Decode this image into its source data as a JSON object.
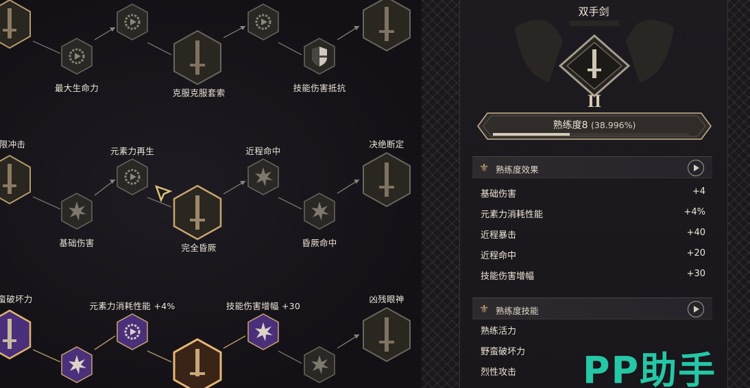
{
  "tree": {
    "row1": {
      "labels": [
        "最大生命力",
        "克服克服套索",
        "技能伤害抵抗"
      ]
    },
    "row2": {
      "labels": [
        "限冲击",
        "元素力再生",
        "近程命中",
        "决绝断定",
        "基础伤害",
        "完全昏厥",
        "昏厥命中"
      ]
    },
    "row3": {
      "labels": [
        "蛮破坏力",
        "元素力消耗性能 +4%",
        "技能伤害增幅 +30",
        "凶残眼神"
      ]
    }
  },
  "panel": {
    "weapon_title": "双手剑",
    "rank": "II",
    "proficiency": {
      "label": "熟练度8",
      "percent_text": "(38.996%)",
      "progress": 0.38996
    },
    "effects": {
      "title": "熟练度效果",
      "rows": [
        {
          "name": "基础伤害",
          "value": "+4"
        },
        {
          "name": "元素力消耗性能",
          "value": "+4%"
        },
        {
          "name": "近程暴击",
          "value": "+40"
        },
        {
          "name": "近程命中",
          "value": "+20"
        },
        {
          "name": "技能伤害增幅",
          "value": "+30"
        }
      ]
    },
    "skills": {
      "title": "熟练度技能",
      "rows": [
        "熟练活力",
        "野蛮破坏力",
        "烈性攻击"
      ]
    }
  },
  "watermark": "PP助手",
  "colors": {
    "gold": "#c8a872",
    "purple": "#4a2f7a",
    "teal": "#25c7a6"
  },
  "icons": [
    "sword-icon",
    "gear-icon",
    "shield-icon",
    "burst-icon",
    "cursor-icon",
    "play-icon",
    "fleur-icon"
  ]
}
